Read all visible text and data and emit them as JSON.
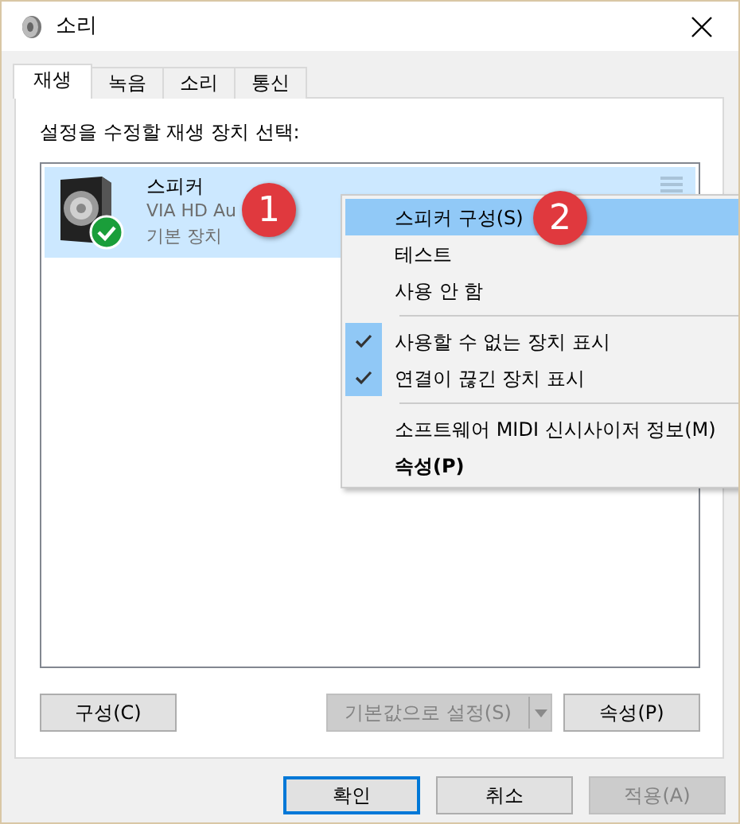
{
  "window": {
    "title": "소리"
  },
  "tabs": [
    {
      "label": "재생",
      "selected": true
    },
    {
      "label": "녹음",
      "selected": false
    },
    {
      "label": "소리",
      "selected": false
    },
    {
      "label": "통신",
      "selected": false
    }
  ],
  "prompt": "설정을 수정할 재생 장치 선택:",
  "devices": [
    {
      "name": "스피커",
      "description": "VIA HD Au",
      "status": "기본 장치",
      "selected": true,
      "default": true
    }
  ],
  "context_menu": {
    "items": [
      {
        "kind": "item",
        "label": "스피커 구성(S)",
        "selected": true,
        "checked": false,
        "bold": false
      },
      {
        "kind": "item",
        "label": "테스트",
        "selected": false,
        "checked": false,
        "bold": false
      },
      {
        "kind": "item",
        "label": "사용 안 함",
        "selected": false,
        "checked": false,
        "bold": false
      },
      {
        "kind": "separator"
      },
      {
        "kind": "item",
        "label": "사용할 수 없는 장치 표시",
        "selected": false,
        "checked": true,
        "bold": false
      },
      {
        "kind": "item",
        "label": "연결이 끊긴 장치 표시",
        "selected": false,
        "checked": true,
        "bold": false
      },
      {
        "kind": "separator"
      },
      {
        "kind": "item",
        "label": "소프트웨어 MIDI 신시사이저 정보(M)",
        "selected": false,
        "checked": false,
        "bold": false
      },
      {
        "kind": "item",
        "label": "속성(P)",
        "selected": false,
        "checked": false,
        "bold": true
      }
    ]
  },
  "callouts": [
    {
      "label": "1"
    },
    {
      "label": "2"
    }
  ],
  "panel_buttons": {
    "configure": {
      "label": "구성(C)",
      "disabled": false
    },
    "set_default": {
      "label": "기본값으로 설정(S)",
      "disabled": true
    },
    "properties": {
      "label": "속성(P)",
      "disabled": false
    }
  },
  "dialog_buttons": [
    {
      "label": "확인",
      "focused": true,
      "disabled": false
    },
    {
      "label": "취소",
      "focused": false,
      "disabled": false
    },
    {
      "label": "적용(A)",
      "focused": false,
      "disabled": true
    }
  ]
}
